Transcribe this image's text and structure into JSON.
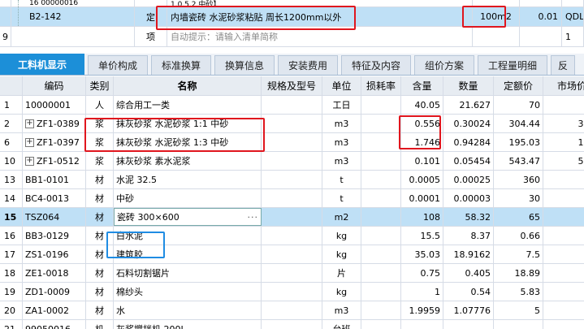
{
  "top_grid": {
    "row0": {
      "code": "16 00000016",
      "name": "1.0.5.2 中砂】"
    },
    "row1": {
      "code": "B2-142",
      "type": "定",
      "name": "内墙瓷砖 水泥砂浆粘贴 周长1200mm以外",
      "unit": "100m2",
      "qty": "0.01",
      "extra": "QDL"
    },
    "row2": {
      "num": "9",
      "type": "项",
      "placeholder": "自动提示：请输入清单简称",
      "extra": "1"
    }
  },
  "tabs": [
    "工料机显示",
    "单价构成",
    "标准换算",
    "换算信息",
    "安装费用",
    "特征及内容",
    "组价方案",
    "工程量明细",
    "反"
  ],
  "columns": [
    "编码",
    "类别",
    "名称",
    "规格及型号",
    "单位",
    "损耗率",
    "含量",
    "数量",
    "定额价",
    "市场价"
  ],
  "rows": [
    {
      "idx": "1",
      "code": "10000001",
      "cat": "人",
      "name": "综合用工一类",
      "unit": "工日",
      "content": "40.05",
      "qty": "21.627",
      "price": "70",
      "market": "",
      "expand": false
    },
    {
      "idx": "2",
      "code": "ZF1-0389",
      "cat": "浆",
      "name": "抹灰砂浆 水泥砂浆 1:1 中砂",
      "unit": "m3",
      "content": "0.556",
      "qty": "0.30024",
      "price": "304.44",
      "market": "304.",
      "expand": true
    },
    {
      "idx": "6",
      "code": "ZF1-0397",
      "cat": "浆",
      "name": "抹灰砂浆 水泥砂浆 1:3 中砂",
      "unit": "m3",
      "content": "1.746",
      "qty": "0.94284",
      "price": "195.03",
      "market": "195.",
      "expand": true
    },
    {
      "idx": "10",
      "code": "ZF1-0512",
      "cat": "浆",
      "name": "抹灰砂浆 素水泥浆",
      "unit": "m3",
      "content": "0.101",
      "qty": "0.05454",
      "price": "543.47",
      "market": "543.",
      "expand": true
    },
    {
      "idx": "13",
      "code": "BB1-0101",
      "cat": "材",
      "name": "水泥 32.5",
      "unit": "t",
      "content": "0.0005",
      "qty": "0.00025",
      "price": "360",
      "market": "3",
      "expand": false
    },
    {
      "idx": "14",
      "code": "BC4-0013",
      "cat": "材",
      "name": "中砂",
      "unit": "t",
      "content": "0.0001",
      "qty": "0.00003",
      "price": "30",
      "market": "",
      "expand": false
    },
    {
      "idx": "15",
      "code": "TSZ064",
      "cat": "材",
      "name": "瓷砖 300×600",
      "unit": "m2",
      "content": "108",
      "qty": "58.32",
      "price": "65",
      "market": "",
      "expand": false,
      "selected": true
    },
    {
      "idx": "16",
      "code": "BB3-0129",
      "cat": "材",
      "name": "白水泥",
      "unit": "kg",
      "content": "15.5",
      "qty": "8.37",
      "price": "0.66",
      "market": "0.",
      "expand": false
    },
    {
      "idx": "17",
      "code": "ZS1-0196",
      "cat": "材",
      "name": "建筑胶",
      "unit": "kg",
      "content": "35.03",
      "qty": "18.9162",
      "price": "7.5",
      "market": "7",
      "expand": false
    },
    {
      "idx": "18",
      "code": "ZE1-0018",
      "cat": "材",
      "name": "石料切割锯片",
      "unit": "片",
      "content": "0.75",
      "qty": "0.405",
      "price": "18.89",
      "market": "18.",
      "expand": false
    },
    {
      "idx": "19",
      "code": "ZD1-0009",
      "cat": "材",
      "name": "棉纱头",
      "unit": "kg",
      "content": "1",
      "qty": "0.54",
      "price": "5.83",
      "market": "5.",
      "expand": false
    },
    {
      "idx": "20",
      "code": "ZA1-0002",
      "cat": "材",
      "name": "水",
      "unit": "m3",
      "content": "1.9959",
      "qty": "1.07776",
      "price": "5",
      "market": "",
      "expand": false
    },
    {
      "idx": "21",
      "code": "99050016",
      "cat": "机",
      "name": "灰浆搅拌机 200L",
      "unit": "台班",
      "content": "",
      "qty": "",
      "price": "",
      "market": "",
      "expand": false
    }
  ],
  "ellipsis": "···",
  "expand_glyph": "+",
  "colors": {
    "selected_row": "#bfe0f6",
    "active_tab": "#1c8fd8",
    "red_annotation": "#e0161e",
    "blue_annotation": "#1f8ce3"
  }
}
